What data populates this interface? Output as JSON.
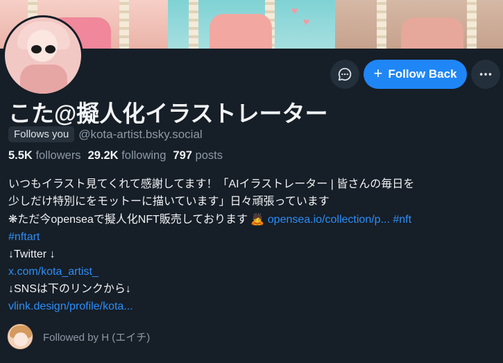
{
  "profile": {
    "display_name": "こた@擬人化イラストレーター",
    "follows_you_badge": "Follows you",
    "handle": "@kota-artist.bsky.social"
  },
  "actions": {
    "message_icon": "chat-bubble-icon",
    "follow_back_label": "Follow Back",
    "follow_back_icon": "+",
    "more_icon": "···"
  },
  "stats": {
    "followers_count": "5.5K",
    "followers_label": "followers",
    "following_count": "29.2K",
    "following_label": "following",
    "posts_count": "797",
    "posts_label": "posts"
  },
  "bio": {
    "line1": "いつもイラスト見てくれて感謝してます！「AIイラストレーター | 皆さんの毎日を",
    "line2": "少しだけ特別にをモットーに描いています」日々頑張っています",
    "line3_text": "❋ただ今openseaで擬人化NFT販売しております",
    "line3_emoji": "🙇",
    "line3_link": "opensea.io/collection/p...",
    "line3_tag": "#nft",
    "line4_tag": "#nftart",
    "line5": "↓Twitter ↓",
    "line6_link": "x.com/kota_artist_",
    "line7": "↓SNSは下のリンクから↓",
    "line8_link": "vlink.design/profile/kota..."
  },
  "followed_by": {
    "text": "Followed by H (エイチ)"
  },
  "colors": {
    "background": "#161e27",
    "accent": "#1f86f5",
    "link": "#2c8ef8",
    "muted": "#8d99a6"
  }
}
